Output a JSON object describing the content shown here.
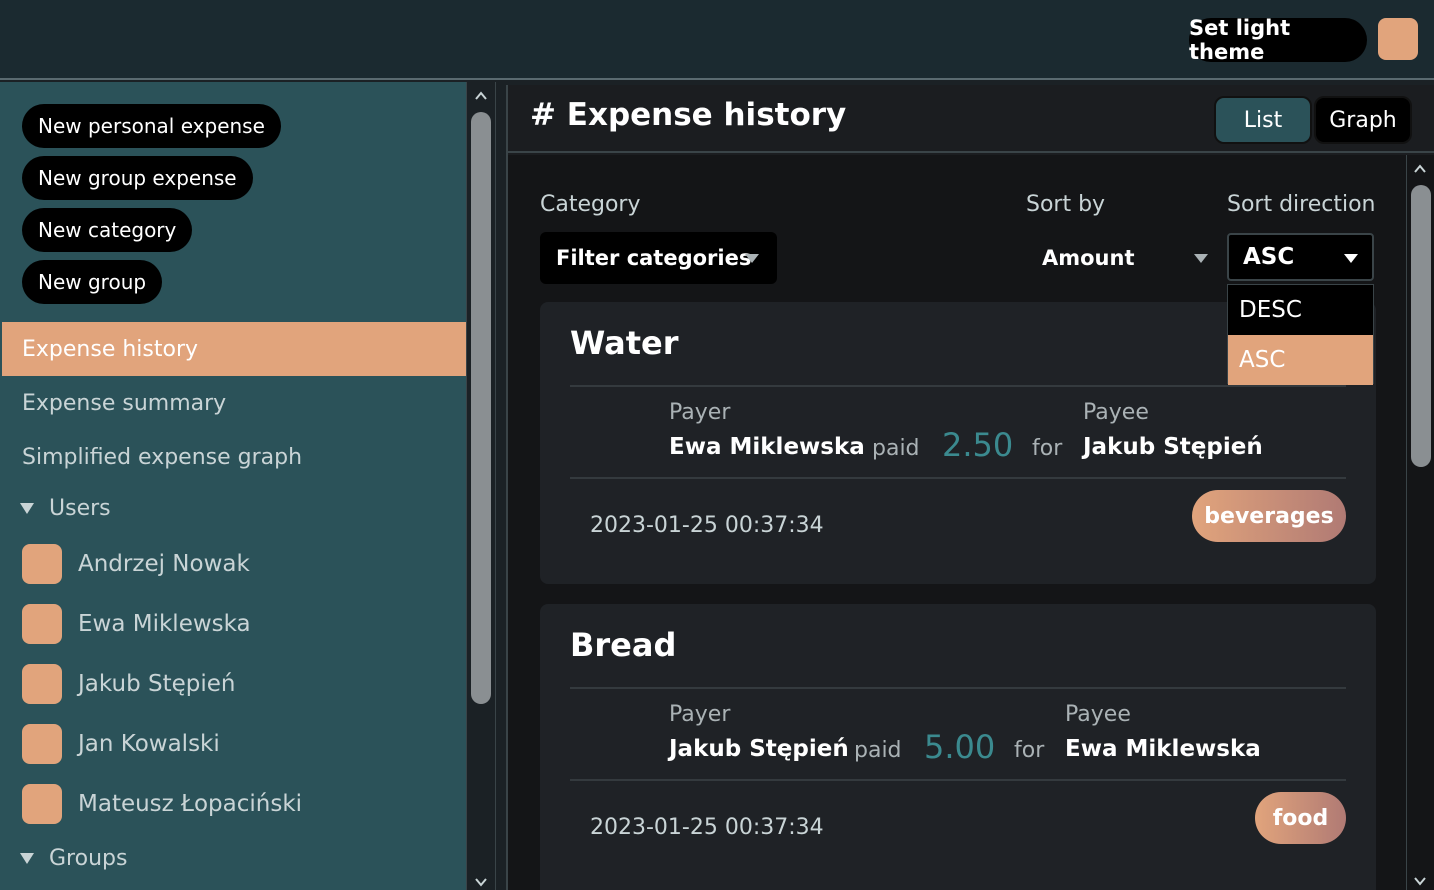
{
  "colors": {
    "accent": "#e1a47c",
    "sidebar_bg": "#2b5259",
    "amount": "#3b8a8f",
    "tag_gradient_start": "#e1a47c",
    "tag_gradient_end": "#b07a74"
  },
  "topbar": {
    "theme_button": "Set light theme",
    "avatar_icon": "user-avatar-icon"
  },
  "sidebar": {
    "actions": [
      "New personal expense",
      "New group expense",
      "New category",
      "New group"
    ],
    "nav": [
      {
        "label": "Expense history",
        "active": true
      },
      {
        "label": "Expense summary",
        "active": false
      },
      {
        "label": "Simplified expense graph",
        "active": false
      }
    ],
    "users_header": "Users",
    "users": [
      "Andrzej Nowak",
      "Ewa Miklewska",
      "Jakub Stępień",
      "Jan Kowalski",
      "Mateusz Łopaciński"
    ],
    "groups_header": "Groups"
  },
  "main": {
    "title": "# Expense history",
    "view_toggle": {
      "list": "List",
      "graph": "Graph",
      "selected": "List"
    },
    "filters": {
      "category_label": "Category",
      "category_placeholder": "Filter categories",
      "sort_by_label": "Sort by",
      "sort_by_value": "Amount",
      "sort_direction_label": "Sort direction",
      "sort_direction_value": "ASC",
      "sort_direction_options": [
        "DESC",
        "ASC"
      ]
    },
    "expenses": [
      {
        "title": "Water",
        "payer_label": "Payer",
        "payer": "Ewa Miklewska",
        "paid_word": "paid",
        "amount": "2.50",
        "for_word": "for",
        "payee_label": "Payee",
        "payee": "Jakub Stępień",
        "date": "2023-01-25 00:37:34",
        "tag": "beverages"
      },
      {
        "title": "Bread",
        "payer_label": "Payer",
        "payer": "Jakub Stępień",
        "paid_word": "paid",
        "amount": "5.00",
        "for_word": "for",
        "payee_label": "Payee",
        "payee": "Ewa Miklewska",
        "date": "2023-01-25 00:37:34",
        "tag": "food"
      }
    ]
  }
}
